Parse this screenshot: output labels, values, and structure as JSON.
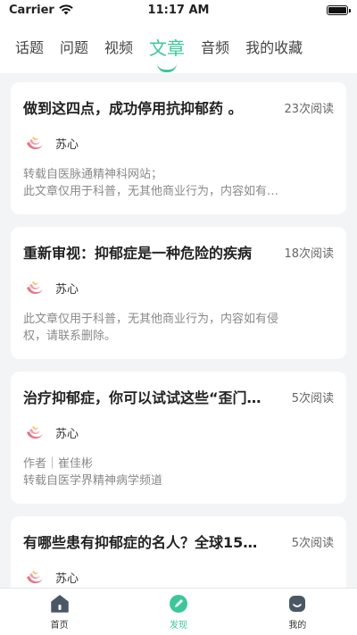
{
  "status": {
    "carrier": "Carrier",
    "time": "11:17 AM"
  },
  "tabs": [
    {
      "label": "话题",
      "active": false
    },
    {
      "label": "问题",
      "active": false
    },
    {
      "label": "视频",
      "active": false
    },
    {
      "label": "文章",
      "active": true
    },
    {
      "label": "音频",
      "active": false
    },
    {
      "label": "我的收藏",
      "active": false
    }
  ],
  "articles": [
    {
      "title": "做到这四点，成功停用抗抑郁药 。",
      "reads": "23次阅读",
      "author": "苏心",
      "excerpt": [
        "转载自医脉通精神科网站；",
        "此文章仅用于科普，无其他商业行为，内容如有…"
      ]
    },
    {
      "title": "重新审视：抑郁症是一种危险的疾病",
      "reads": "18次阅读",
      "author": "苏心",
      "excerpt": [
        "此文章仅用于科普，无其他商业行为，内容如有侵",
        "权，请联系删除。"
      ]
    },
    {
      "title": "治疗抑郁症，你可以试试这些“歪门…",
      "reads": "5次阅读",
      "author": "苏心",
      "excerpt": [
        "作者｜崔佳彬",
        "转载自医学界精神病学频道"
      ]
    },
    {
      "title": "有哪些患有抑郁症的名人？全球15…",
      "reads": "5次阅读",
      "author": "苏心",
      "excerpt": [
        "",
        ""
      ]
    }
  ],
  "nav": {
    "home": "首页",
    "discover": "发现",
    "mine": "我的"
  },
  "colors": {
    "accent": "#3cc79b",
    "icon_gray": "#4a5866"
  }
}
